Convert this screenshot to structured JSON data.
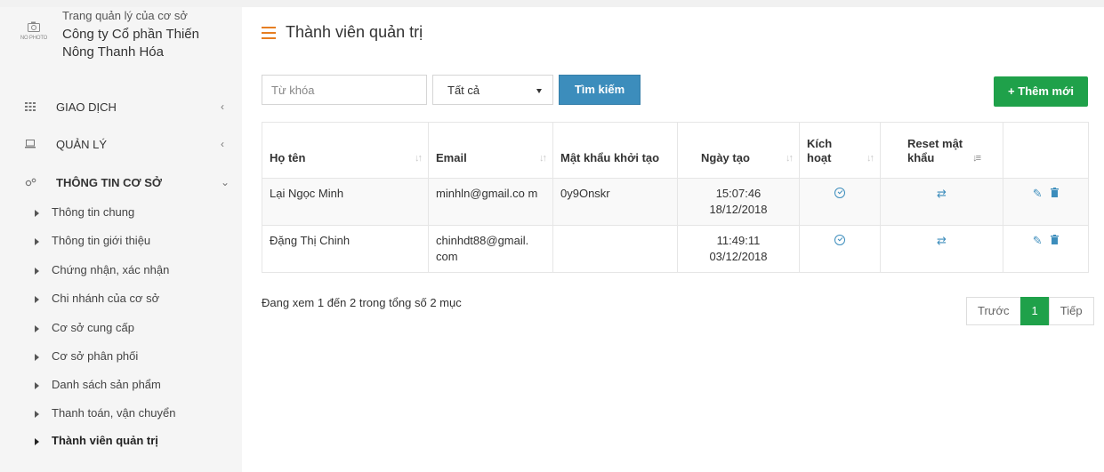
{
  "sidebar": {
    "profile": {
      "subtitle": "Trang quản lý của cơ sở",
      "company": "Công ty Cổ phần Thiến Nông Thanh Hóa",
      "photo_placeholder": "NO PHOTO"
    },
    "menu": [
      {
        "label": "GIAO DỊCH",
        "icon": "grid-icon"
      },
      {
        "label": "QUẢN LÝ",
        "icon": "laptop-icon"
      },
      {
        "label": "THÔNG TIN CƠ SỞ",
        "icon": "cogs-icon"
      }
    ],
    "sub_items": [
      {
        "label": "Thông tin chung"
      },
      {
        "label": "Thông tin giới thiệu"
      },
      {
        "label": "Chứng nhận, xác nhận"
      },
      {
        "label": "Chi nhánh của cơ sở"
      },
      {
        "label": "Cơ sở cung cấp"
      },
      {
        "label": "Cơ sở phân phối"
      },
      {
        "label": "Danh sách sản phẩm"
      },
      {
        "label": "Thanh toán, vận chuyển"
      },
      {
        "label": "Thành viên quản trị"
      }
    ]
  },
  "main": {
    "title": "Thành viên quản trị",
    "search": {
      "placeholder": "Từ khóa",
      "select_value": "Tất cả",
      "button": "Tìm kiếm"
    },
    "add_button": "Thêm mới",
    "table": {
      "headers": [
        "Họ tên",
        "Email",
        "Mật khẩu khởi tạo",
        "Ngày tạo",
        "Kích hoạt",
        "Reset mật khẩu",
        ""
      ],
      "rows": [
        {
          "name": "Lại Ngọc Minh",
          "email": "minhln@gmail.co m",
          "password": "0y9Onskr",
          "time": "15:07:46",
          "date": "18/12/2018"
        },
        {
          "name": "Đặng Thị Chinh",
          "email": "chinhdt88@gmail. com",
          "password": "",
          "time": "11:49:11",
          "date": "03/12/2018"
        }
      ]
    },
    "info": "Đang xem 1 đến 2 trong tổng số 2 mục",
    "pagination": {
      "prev": "Trước",
      "current": "1",
      "next": "Tiếp"
    }
  },
  "colors": {
    "accent": "#3c8dbc",
    "success": "#1fa14a",
    "title_icon": "#e67e22"
  }
}
